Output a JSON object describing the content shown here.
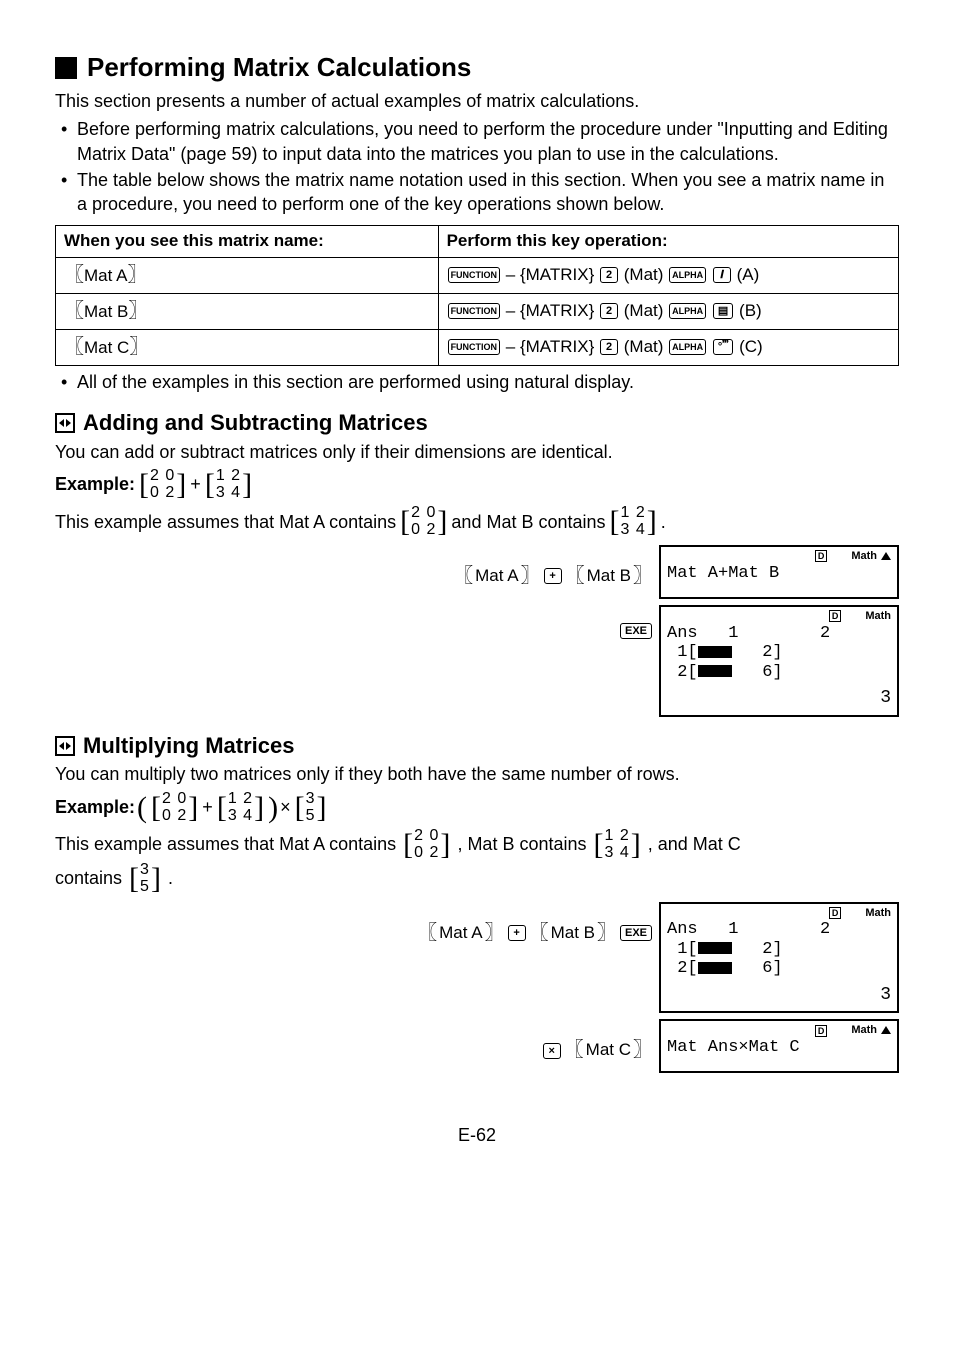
{
  "title": "Performing Matrix Calculations",
  "intro": "This section presents a number of actual examples of matrix calculations.",
  "bullet1": "Before performing matrix calculations, you need to perform the procedure under \"Inputting and Editing Matrix Data\" (page 59) to input data into the matrices you plan to use in the calculations.",
  "bullet2": "The table below shows the matrix name notation used in this section. When you see a matrix name in a procedure, you need to perform one of the key operations shown below.",
  "table": {
    "h1": "When you see this matrix name:",
    "h2": "Perform this key operation:",
    "r1c1": "Mat A",
    "r2c1": "Mat B",
    "r3c1": "Mat C",
    "fn": "FUNCTION",
    "matrix": " – {MATRIX}",
    "two": "2",
    "mat": "(Mat)",
    "alpha": "ALPHA",
    "kA": "𝒊",
    "kB": "▤",
    "kC": "°𝄒𝄒𝄒",
    "sA": "(A)",
    "sB": "(B)",
    "sC": "(C)"
  },
  "afterTbl": "All of the examples in this section are performed using natural display.",
  "sec1": {
    "head": "Adding and Subtracting Matrices",
    "body": "You can add or subtract matrices only if their dimensions are identical.",
    "exLabel": "Example:",
    "assume_pre": "This example assumes that Mat A contains ",
    "assume_mid": " and Mat B contains ",
    "period": ".",
    "matA_bracket": "Mat A",
    "matB_bracket": "Mat B",
    "plus": "+",
    "exe": "EXE"
  },
  "matA": {
    "r1": "2 0",
    "r2": "0 2"
  },
  "matB": {
    "r1": "1 2",
    "r2": "3 4"
  },
  "matC": {
    "r1": "3",
    "r2": "5"
  },
  "scr1": {
    "d": "D",
    "math": "Math",
    "body": "Mat A+Mat B"
  },
  "scr2": {
    "d": "D",
    "math": "Math",
    "l1": "Ans   1        2",
    "l2": " 1[",
    "l2b": "   2]",
    "l3": " 2[",
    "l3b": "   6]",
    "res": "3"
  },
  "sec2": {
    "head": "Multiplying Matrices",
    "body": "You can multiply two matrices only if they both have the same number of rows.",
    "exLabel": "Example:",
    "assume_pre": "This example assumes that Mat A contains ",
    "assume_mid1": ", Mat B contains ",
    "assume_mid2": ", and Mat C ",
    "contains": "contains ",
    "period": ".",
    "matC_bracket": "Mat C",
    "times": "×"
  },
  "scr3": {
    "d": "D",
    "math": "Math",
    "l1": "Ans   1        2",
    "l2": " 1[",
    "l2b": "   2]",
    "l3": " 2[",
    "l3b": "   6]",
    "res": "3"
  },
  "scr4": {
    "d": "D",
    "math": "Math",
    "body": "Mat Ans×Mat C"
  },
  "pageNum": "E-62"
}
